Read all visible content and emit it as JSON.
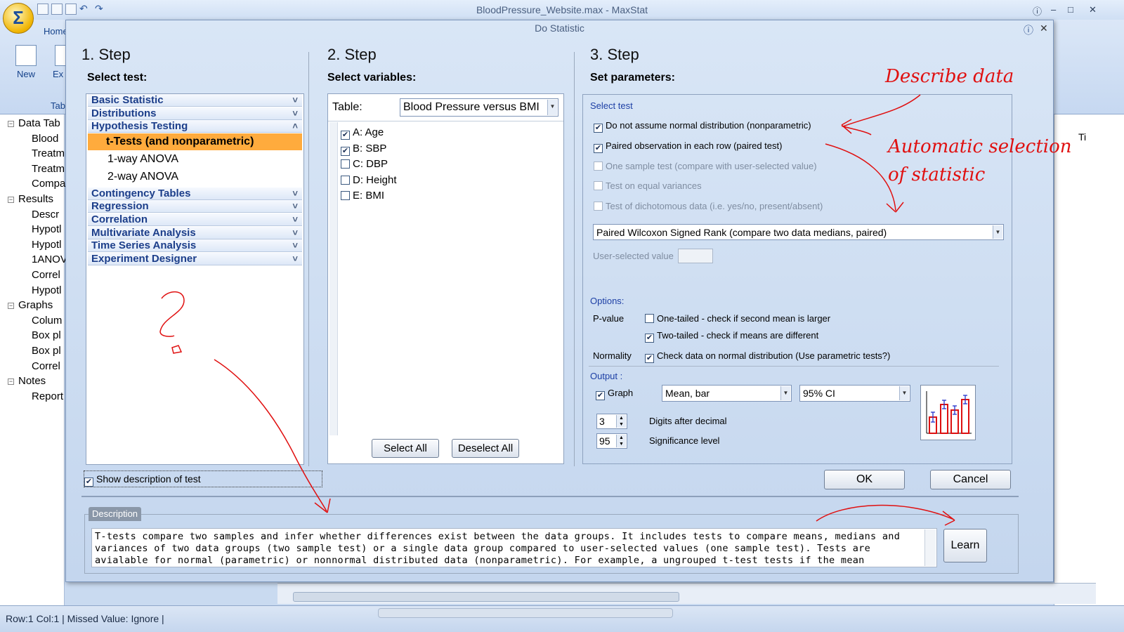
{
  "app": {
    "title": "BloodPressure_Website.max - MaxStat",
    "ribbon_tab": "Home",
    "ribbon_buttons": [
      "New",
      "Ex"
    ],
    "ribbon_group": "Tab",
    "accent": "#ffab3d"
  },
  "tree": {
    "items": [
      {
        "label": "Data Tab",
        "level": 0
      },
      {
        "label": "Blood",
        "level": 1
      },
      {
        "label": "Treatm",
        "level": 1
      },
      {
        "label": "Treatm",
        "level": 1
      },
      {
        "label": "Compa",
        "level": 1
      },
      {
        "label": "Results",
        "level": 0
      },
      {
        "label": "Descr",
        "level": 1
      },
      {
        "label": "Hypotl",
        "level": 1
      },
      {
        "label": "Hypotl",
        "level": 1
      },
      {
        "label": "1ANOV",
        "level": 1
      },
      {
        "label": "Correl",
        "level": 1
      },
      {
        "label": "Hypotl",
        "level": 1
      },
      {
        "label": "Graphs",
        "level": 0
      },
      {
        "label": "Colum",
        "level": 1
      },
      {
        "label": "Box pl",
        "level": 1
      },
      {
        "label": "Box pl",
        "level": 1
      },
      {
        "label": "Correl",
        "level": 1
      },
      {
        "label": "Notes",
        "level": 0
      },
      {
        "label": "Report",
        "level": 1
      }
    ]
  },
  "status": {
    "text": "Row:1 Col:1 | Missed Value: Ignore |"
  },
  "grid_header": "Ti",
  "dialog": {
    "title": "Do Statistic",
    "step1": {
      "heading": "1. Step",
      "sub": "Select test:",
      "categories": [
        {
          "label": "Basic Statistic",
          "expanded": false
        },
        {
          "label": "Distributions",
          "expanded": false
        },
        {
          "label": "Hypothesis Testing",
          "expanded": true,
          "items": [
            "t-Tests (and nonparametric)",
            "1-way ANOVA",
            "2-way ANOVA"
          ],
          "selected": 0
        },
        {
          "label": "Contingency Tables",
          "expanded": false
        },
        {
          "label": "Regression",
          "expanded": false
        },
        {
          "label": "Correlation",
          "expanded": false
        },
        {
          "label": "Multivariate Analysis",
          "expanded": false
        },
        {
          "label": "Time Series Analysis",
          "expanded": false
        },
        {
          "label": "Experiment Designer",
          "expanded": false
        }
      ],
      "show_description_label": "Show description of test",
      "show_description_checked": true
    },
    "step2": {
      "heading": "2. Step",
      "sub": "Select variables:",
      "table_label": "Table:",
      "table_value": "Blood Pressure versus BMI",
      "variables": [
        {
          "label": "A: Age",
          "checked": true
        },
        {
          "label": "B: SBP",
          "checked": true
        },
        {
          "label": "C: DBP",
          "checked": false
        },
        {
          "label": "D: Height",
          "checked": false
        },
        {
          "label": "E: BMI",
          "checked": false
        }
      ],
      "select_all": "Select All",
      "deselect_all": "Deselect All"
    },
    "step3": {
      "heading": "3. Step",
      "sub": "Set parameters:",
      "select_test_label": "Select test",
      "checks": [
        {
          "label": "Do not assume normal distribution (nonparametric)",
          "checked": true,
          "enabled": true
        },
        {
          "label": "Paired observation in each row (paired test)",
          "checked": true,
          "enabled": true
        },
        {
          "label": "One sample test (compare with user-selected value)",
          "checked": false,
          "enabled": false
        },
        {
          "label": "Test on equal variances",
          "checked": false,
          "enabled": false
        },
        {
          "label": "Test of dichotomous data (i.e. yes/no, present/absent)",
          "checked": false,
          "enabled": false
        }
      ],
      "test_select": "Paired Wilcoxon Signed Rank (compare two data medians, paired)",
      "user_value_label": "User-selected value",
      "user_value": "",
      "options_label": "Options:",
      "pvalue_label": "P-value",
      "one_tailed": {
        "label": "One-tailed  -  check if second mean is larger",
        "checked": false
      },
      "two_tailed": {
        "label": "Two-tailed  -  check if means are different",
        "checked": true
      },
      "normality_label": "Normality",
      "normality_check": {
        "label": "Check data on normal distribution (Use parametric tests?)",
        "checked": true
      },
      "output_label": "Output :",
      "graph_label": "Graph",
      "graph_checked": true,
      "graph_type": "Mean, bar",
      "graph_ci": "95% CI",
      "digits_value": "3",
      "digits_label": "Digits after decimal",
      "signif_value": "95",
      "signif_label": "Significance level"
    },
    "ok": "OK",
    "cancel": "Cancel",
    "description_tab": "Description",
    "description_text": "T-tests compare two samples and infer whether differences exist between the data groups. It includes tests to compare means, medians and variances of two data groups (two sample test) or a single data group compared to user-selected values (one sample test). Tests are avialable for normal (parametric) or nonnormal distributed data (nonparametric). For example, a ungrouped t-test tests if the mean concentrations of a pesticide differ significantly between two groups.",
    "learn": "Learn"
  },
  "annotations": {
    "describe": "Describe data",
    "auto1": "Automatic selection",
    "auto2": "of statistic",
    "question": "?",
    "color": "#e01010"
  }
}
